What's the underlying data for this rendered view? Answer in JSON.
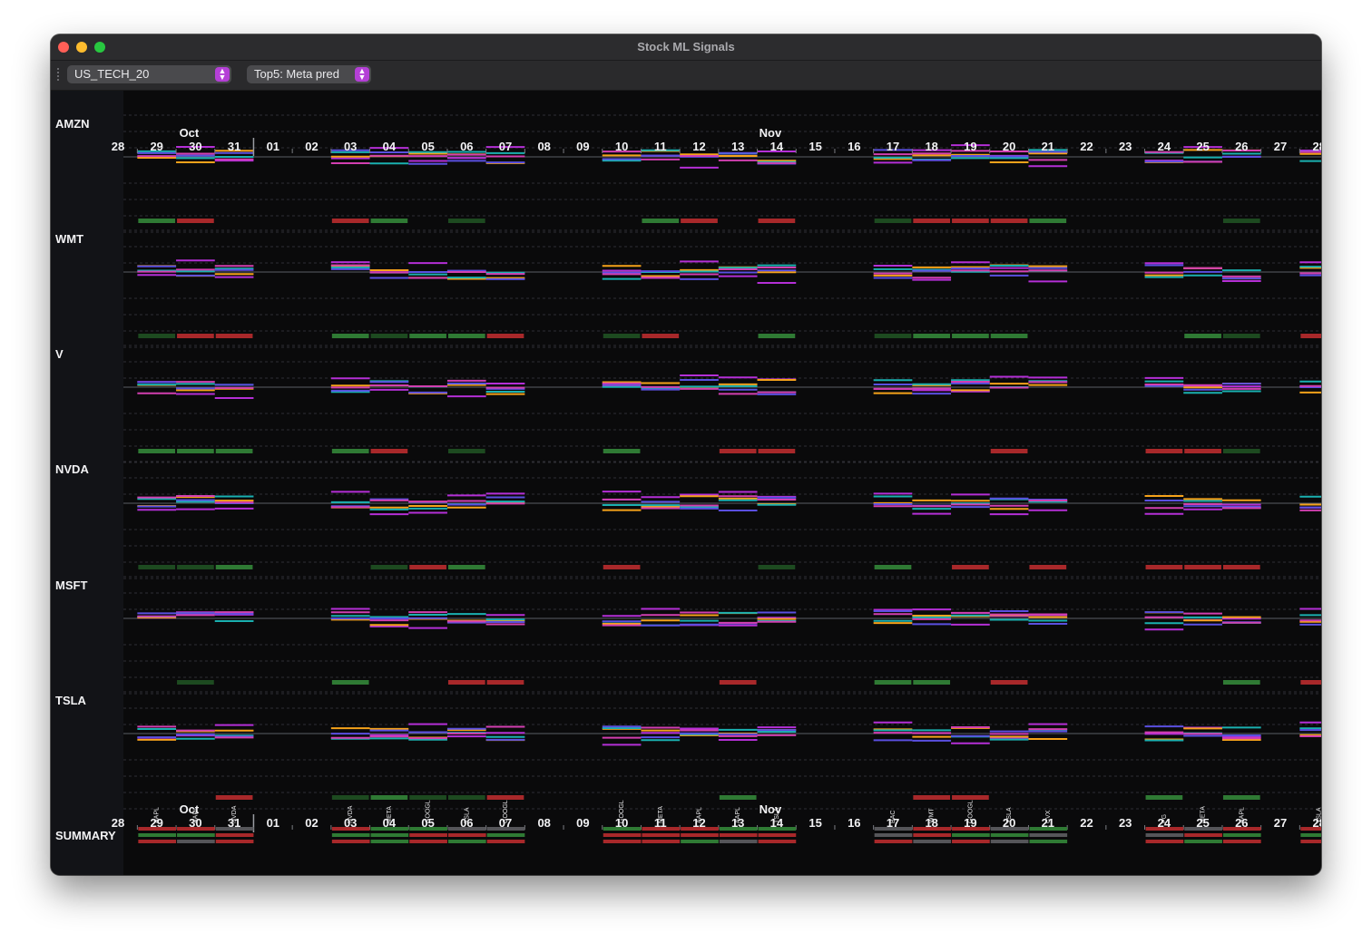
{
  "window": {
    "title": "Stock ML Signals"
  },
  "toolbar": {
    "universe_select": {
      "value": "US_TECH_20"
    },
    "model_select": {
      "value": "Top5: Meta pred"
    }
  },
  "rows": [
    {
      "label": "AMZN"
    },
    {
      "label": "WMT"
    },
    {
      "label": "V"
    },
    {
      "label": "NVDA"
    },
    {
      "label": "MSFT"
    },
    {
      "label": "TSLA"
    }
  ],
  "summary_label": "SUMMARY",
  "timeline": {
    "days": [
      {
        "d": "28",
        "w": false
      },
      {
        "d": "29",
        "w": false
      },
      {
        "d": "30",
        "w": false
      },
      {
        "d": "31",
        "w": false
      },
      {
        "d": "01",
        "w": true
      },
      {
        "d": "02",
        "w": true
      },
      {
        "d": "03",
        "w": false
      },
      {
        "d": "04",
        "w": false
      },
      {
        "d": "05",
        "w": false
      },
      {
        "d": "06",
        "w": false
      },
      {
        "d": "07",
        "w": false
      },
      {
        "d": "08",
        "w": true
      },
      {
        "d": "09",
        "w": true
      },
      {
        "d": "10",
        "w": false
      },
      {
        "d": "11",
        "w": false
      },
      {
        "d": "12",
        "w": false
      },
      {
        "d": "13",
        "w": false
      },
      {
        "d": "14",
        "w": false
      },
      {
        "d": "15",
        "w": true
      },
      {
        "d": "16",
        "w": true
      },
      {
        "d": "17",
        "w": false
      },
      {
        "d": "18",
        "w": false
      },
      {
        "d": "19",
        "w": false
      },
      {
        "d": "20",
        "w": false
      },
      {
        "d": "21",
        "w": false
      },
      {
        "d": "22",
        "w": true
      },
      {
        "d": "23",
        "w": true
      },
      {
        "d": "24",
        "w": false
      },
      {
        "d": "25",
        "w": false
      },
      {
        "d": "26",
        "w": false
      },
      {
        "d": "27",
        "w": true
      },
      {
        "d": "28",
        "w": false
      }
    ],
    "months": [
      {
        "label": "Oct",
        "day_index": 2
      },
      {
        "label": "Nov",
        "day_index": 17
      }
    ],
    "month_divider_index": 4
  },
  "summary_picks": [
    {
      "day_index": 1,
      "ticker": "AAPL"
    },
    {
      "day_index": 2,
      "ticker": "AAPL"
    },
    {
      "day_index": 3,
      "ticker": "NVDA"
    },
    {
      "day_index": 6,
      "ticker": "NVDA"
    },
    {
      "day_index": 7,
      "ticker": "META"
    },
    {
      "day_index": 8,
      "ticker": "GOOGL"
    },
    {
      "day_index": 9,
      "ticker": "TSLA"
    },
    {
      "day_index": 10,
      "ticker": "GOOGL"
    },
    {
      "day_index": 13,
      "ticker": "GOOGL"
    },
    {
      "day_index": 14,
      "ticker": "META"
    },
    {
      "day_index": 15,
      "ticker": "AAPL"
    },
    {
      "day_index": 16,
      "ticker": "AAPL"
    },
    {
      "day_index": 17,
      "ticker": "TSLA"
    },
    {
      "day_index": 20,
      "ticker": "BAC"
    },
    {
      "day_index": 21,
      "ticker": "WMT"
    },
    {
      "day_index": 22,
      "ticker": "GOOGL"
    },
    {
      "day_index": 23,
      "ticker": "TSLA"
    },
    {
      "day_index": 24,
      "ticker": "CVX"
    },
    {
      "day_index": 27,
      "ticker": "PG"
    },
    {
      "day_index": 28,
      "ticker": "META"
    },
    {
      "day_index": 29,
      "ticker": "AAPL"
    },
    {
      "day_index": 31,
      "ticker": "TSLA"
    }
  ],
  "colors": {
    "series": [
      "#b42fd6",
      "#f5a21a",
      "#1ab0b0",
      "#5a4fe0",
      "#d23fb0"
    ],
    "signal_up": "#2f7a34",
    "signal_down": "#a8282a",
    "signal_weak_up": "#1d4a20",
    "axis_line": "#5b5e66",
    "grid_dash": "#2e2f34"
  }
}
